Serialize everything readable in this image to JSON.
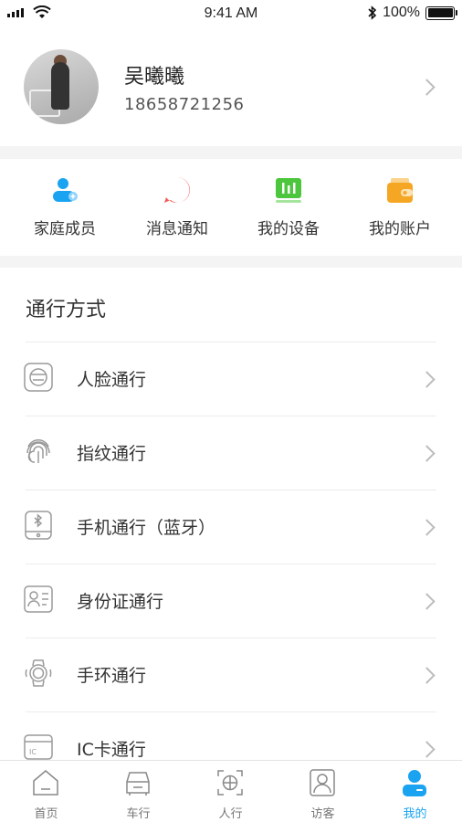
{
  "status_bar": {
    "time": "9:41 AM",
    "battery": "100%"
  },
  "profile": {
    "name": "吴曦曦",
    "phone": "18658721256"
  },
  "quick_actions": [
    {
      "label": "家庭成员",
      "icon": "family-member-icon",
      "color": "#1aa3f0"
    },
    {
      "label": "消息通知",
      "icon": "message-icon",
      "color": "#f25a5a"
    },
    {
      "label": "我的设备",
      "icon": "device-icon",
      "color": "#4cc63d"
    },
    {
      "label": "我的账户",
      "icon": "wallet-icon",
      "color": "#f5a623"
    }
  ],
  "access": {
    "title": "通行方式",
    "items": [
      {
        "label": "人脸通行",
        "icon": "face-icon"
      },
      {
        "label": "指纹通行",
        "icon": "fingerprint-icon"
      },
      {
        "label": "手机通行（蓝牙）",
        "icon": "bluetooth-phone-icon"
      },
      {
        "label": "身份证通行",
        "icon": "id-card-icon"
      },
      {
        "label": "手环通行",
        "icon": "wristband-icon"
      },
      {
        "label": "IC卡通行",
        "icon": "ic-card-icon"
      }
    ]
  },
  "tabs": [
    {
      "label": "首页",
      "icon": "home-icon"
    },
    {
      "label": "车行",
      "icon": "car-icon"
    },
    {
      "label": "人行",
      "icon": "face-scan-icon"
    },
    {
      "label": "访客",
      "icon": "visitor-icon"
    },
    {
      "label": "我的",
      "icon": "profile-icon",
      "active": true
    }
  ],
  "colors": {
    "accent": "#1aa3f0",
    "inactive": "#777777"
  }
}
